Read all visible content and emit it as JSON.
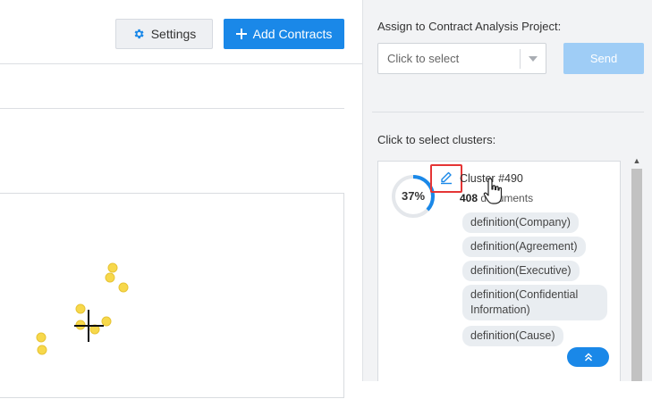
{
  "toolbar": {
    "settings_label": "Settings",
    "add_contracts_label": "Add Contracts"
  },
  "panel": {
    "assign_label": "Assign to Contract Analysis Project:",
    "project_select": {
      "value": "Click to select"
    },
    "send_label": "Send",
    "clusters_label": "Click to select clusters:"
  },
  "cluster": {
    "percent_text": "37%",
    "percent_value": 0.37,
    "title": "Cluster #490",
    "doc_count": "408",
    "doc_suffix": " documents",
    "tags": [
      "definition(Company)",
      "definition(Agreement)",
      "definition(Executive)",
      "definition(Confidential Information)",
      "definition(Cause)"
    ]
  },
  "colors": {
    "primary": "#1a88e8",
    "send_disabled": "#9fcdf6",
    "highlight_box": "#e53535",
    "point_fill": "#f7d84b"
  },
  "icons": [
    "gear-icon",
    "plus-icon",
    "pencil-icon",
    "chevron-double-up-icon",
    "hand-cursor-icon",
    "crosshair-icon"
  ]
}
